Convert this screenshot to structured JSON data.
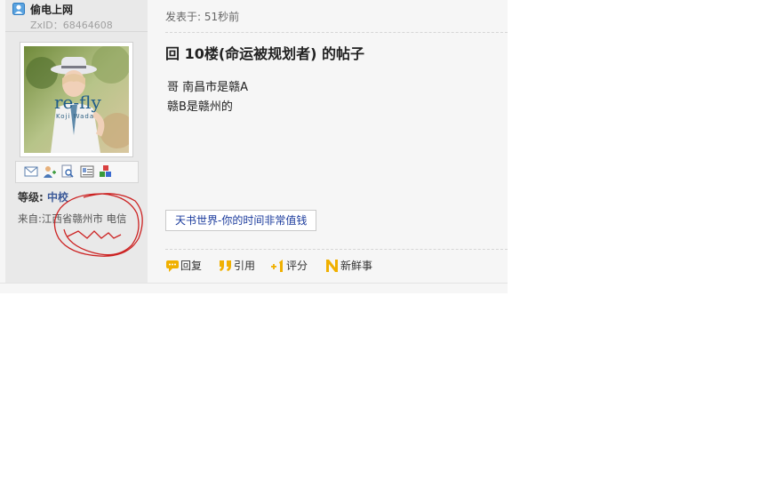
{
  "user": {
    "name": "偷电上网",
    "zxid": "ZxID：68464608",
    "avatar": {
      "text_main": "re-fly",
      "text_sub": "Koji Wada",
      "colors": {
        "hat": "#e8e8ec",
        "shirt": "#f2f2f2",
        "accent": "#1f5c8a"
      }
    },
    "action_icons": [
      "mail-icon",
      "add-friend-icon",
      "profile-icon",
      "card-icon",
      "blocks-icon"
    ],
    "level_label": "等级:",
    "level_value": "中校",
    "from": "来自:江西省赣州市 电信"
  },
  "post": {
    "posted": "发表于: 51秒前",
    "title": "回 10楼(命运被规划者) 的帖子",
    "lines": [
      "哥 南昌市是赣A",
      "赣B是赣州的"
    ],
    "signature": "天书世界-你的时间非常值钱",
    "actions": [
      {
        "icon": "reply-icon",
        "label": "回复"
      },
      {
        "icon": "quote-icon",
        "label": "引用"
      },
      {
        "icon": "rate-icon",
        "label": "评分"
      },
      {
        "icon": "news-icon",
        "label": "新鲜事"
      }
    ]
  },
  "colors": {
    "accent_blue": "#3b5998",
    "annotation_red": "#cc2222",
    "link_blue": "#1a3a9c"
  }
}
